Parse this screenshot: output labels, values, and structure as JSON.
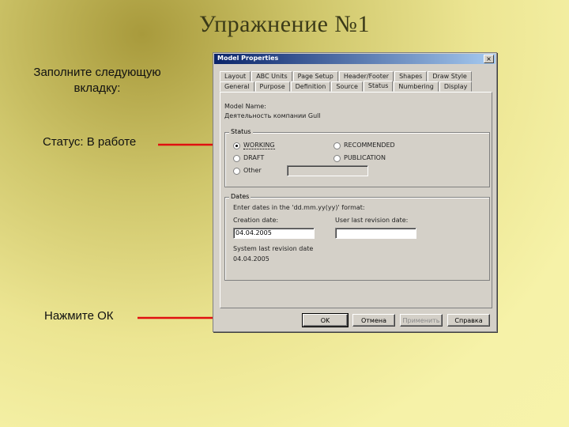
{
  "slide": {
    "title": "Упражнение №1",
    "instruction_fill": "Заполните следующую вкладку:",
    "instruction_status": "Статус: В работе",
    "instruction_ok": "Нажмите ОК"
  },
  "dialog": {
    "title": "Model Properties",
    "close_glyph": "×",
    "tabs_row1": [
      "Layout",
      "ABC Units",
      "Page Setup",
      "Header/Footer",
      "Shapes",
      "Draw Style"
    ],
    "tabs_row2": [
      "General",
      "Purpose",
      "Definition",
      "Source",
      "Status",
      "Numbering",
      "Display"
    ],
    "active_tab": "Status",
    "model_name_label": "Model Name:",
    "model_name_value": "Деятельность компании Gull",
    "status_group": {
      "title": "Status",
      "options": {
        "working": "WORKING",
        "draft": "DRAFT",
        "other": "Other",
        "recommended": "RECOMMENDED",
        "publication": "PUBLICATION"
      },
      "selected": "WORKING",
      "other_value": ""
    },
    "dates_group": {
      "title": "Dates",
      "hint": "Enter dates in the 'dd.mm.yy(yy)' format:",
      "creation_label": "Creation date:",
      "creation_value": "04.04.2005",
      "revision_label": "User last revision date:",
      "revision_value": "",
      "system_label": "System last revision date",
      "system_value": "04.04.2005"
    },
    "buttons": {
      "ok": "OK",
      "cancel": "Отмена",
      "apply": "Применить",
      "help": "Справка"
    }
  },
  "colors": {
    "arrow": "#e01010",
    "titlebar_start": "#0a246a",
    "dialog_bg": "#d4d0c8"
  }
}
